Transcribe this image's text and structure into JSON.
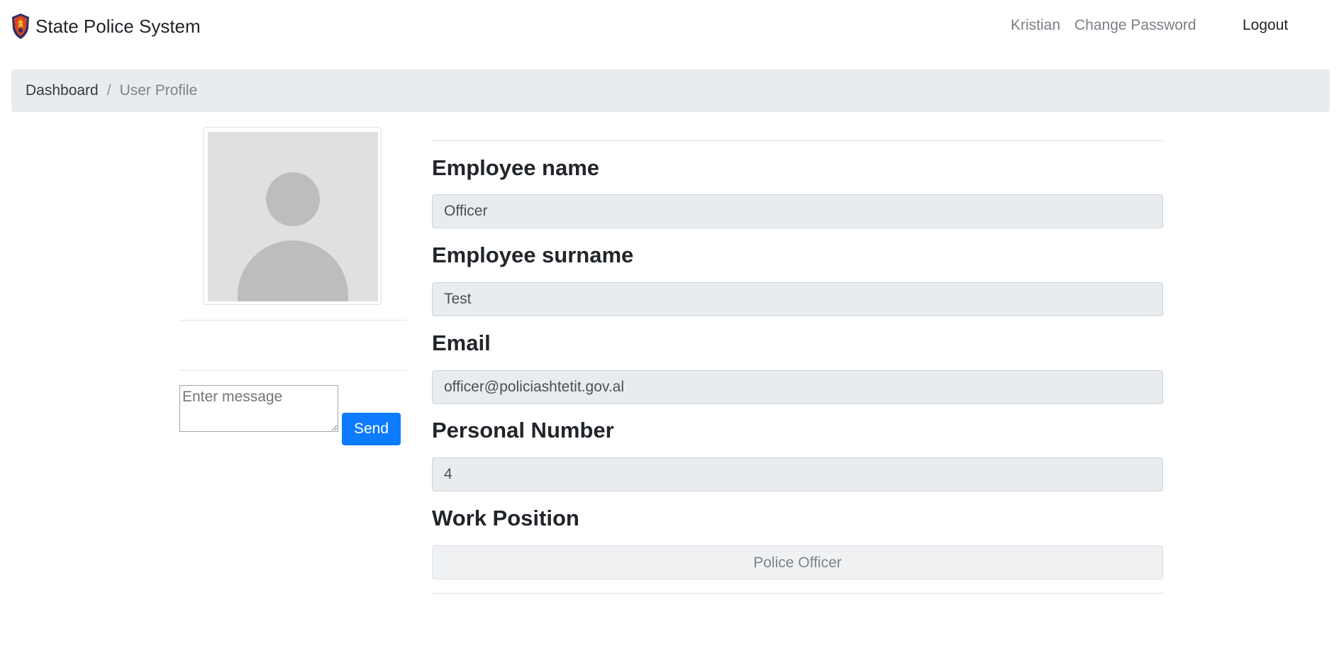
{
  "navbar": {
    "brand": "State Police System",
    "logo_icon": "police-shield-icon",
    "user": "Kristian",
    "change_password": "Change Password",
    "logout": "Logout"
  },
  "breadcrumb": {
    "home": "Dashboard",
    "separator": "/",
    "current": "User Profile"
  },
  "sidebar": {
    "avatar_icon": "user-avatar-placeholder",
    "message_placeholder": "Enter message",
    "send_label": "Send"
  },
  "profile": {
    "name_label": "Employee name",
    "name_value": "Officer",
    "surname_label": "Employee surname",
    "surname_value": "Test",
    "email_label": "Email",
    "email_value": "officer@policiashtetit.gov.al",
    "personal_number_label": "Personal Number",
    "personal_number_value": "4",
    "position_label": "Work Position",
    "position_value": "Police Officer"
  },
  "colors": {
    "primary_button": "#0d7bff",
    "breadcrumb_bg": "#e9ecef",
    "input_bg": "#e9ecef"
  }
}
